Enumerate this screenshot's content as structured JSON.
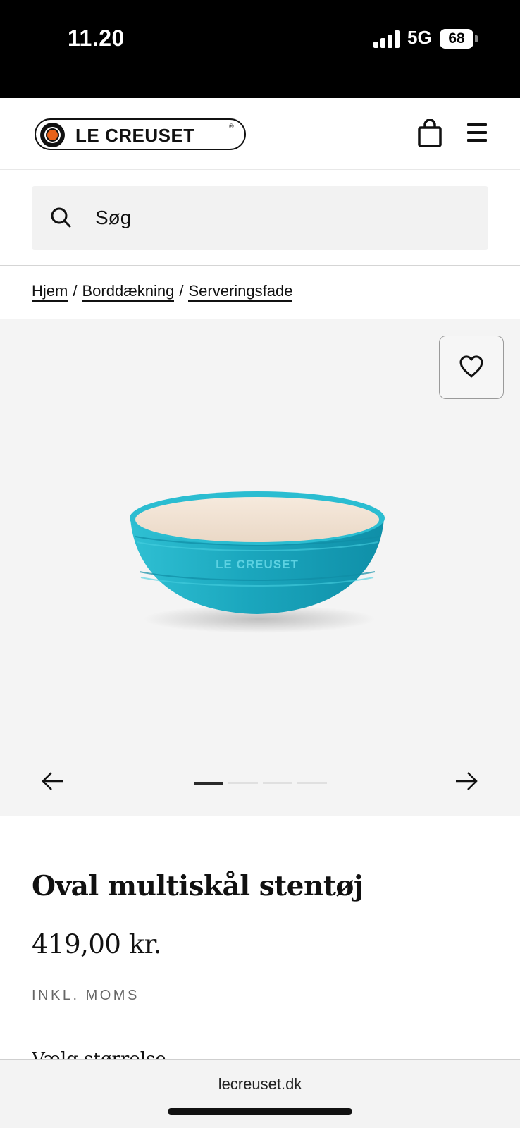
{
  "status_bar": {
    "time": "11.20",
    "network": "5G",
    "battery": "68"
  },
  "header": {
    "logo_text": "LE CREUSET",
    "logo_reg": "®",
    "icons": [
      "logo-icon",
      "shopping-bag-icon",
      "hamburger-menu-icon"
    ]
  },
  "search": {
    "placeholder": "Søg"
  },
  "breadcrumb": {
    "items": [
      "Hjem",
      "Borddækning",
      "Serveringsfade"
    ],
    "separator": "/"
  },
  "gallery": {
    "image_count": 4,
    "active_index": 0,
    "icons": [
      "heart-icon",
      "arrow-left-icon",
      "arrow-right-icon"
    ],
    "bowl_text": "LE CREUSET",
    "bowl_color": "#1fa9c0"
  },
  "product": {
    "title": "Oval multiskål stentøj",
    "price": "419,00 kr.",
    "vat_label": "INKL. MOMS",
    "partial_text": "Vælg størrelse"
  },
  "browser": {
    "url": "lecreuset.dk"
  },
  "colors": {
    "accent": "#e8621a",
    "text": "#111111",
    "muted": "#666666"
  }
}
